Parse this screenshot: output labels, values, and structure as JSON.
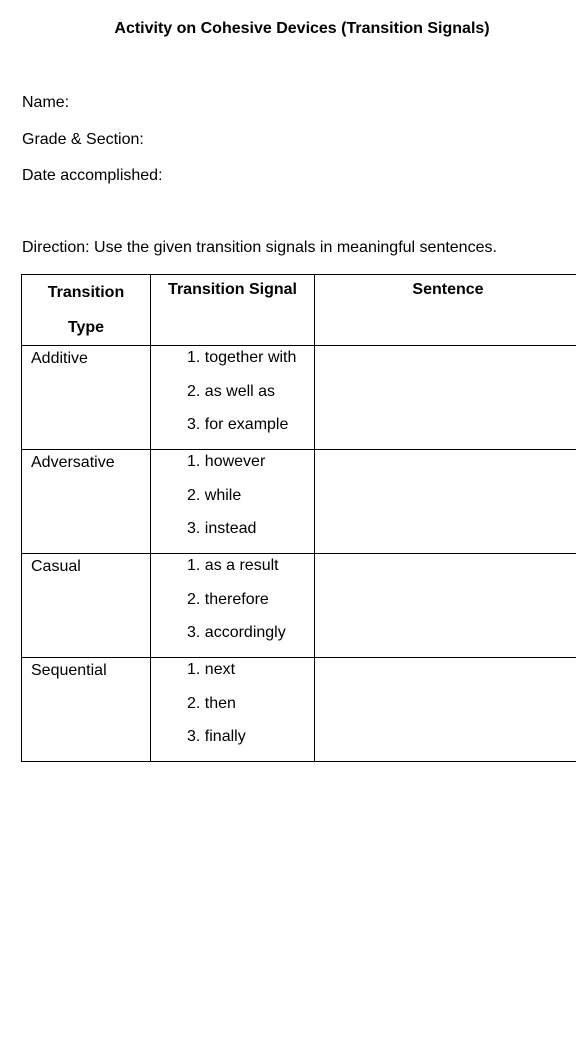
{
  "title": "Activity on Cohesive Devices (Transition Signals)",
  "fields": {
    "name_label": "Name:",
    "grade_section_label": "Grade & Section:",
    "date_label": "Date accomplished:"
  },
  "direction": "Direction: Use the given transition signals in meaningful sentences.",
  "table": {
    "headers": {
      "type_line1": "Transition",
      "type_line2": "Type",
      "signal": "Transition Signal",
      "sentence": "Sentence"
    },
    "rows": [
      {
        "type": "Additive",
        "signals": [
          "1. together with",
          "2. as well as",
          "3. for example"
        ],
        "sentence": ""
      },
      {
        "type": "Adversative",
        "signals": [
          "1. however",
          "2. while",
          "3. instead"
        ],
        "sentence": ""
      },
      {
        "type": "Casual",
        "signals": [
          "1. as a result",
          "2. therefore",
          "3. accordingly"
        ],
        "sentence": ""
      },
      {
        "type": "Sequential",
        "signals": [
          "1. next",
          "2. then",
          "3. finally"
        ],
        "sentence": ""
      }
    ]
  }
}
